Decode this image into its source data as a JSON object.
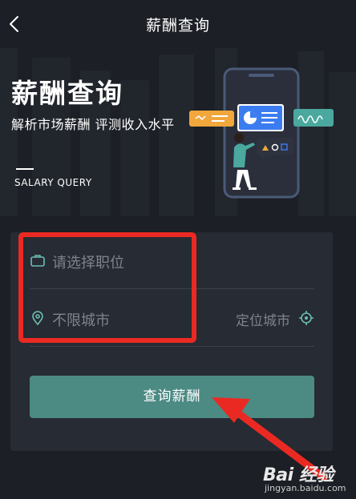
{
  "nav": {
    "title": "薪酬查询",
    "back_icon": "chevron-left-icon"
  },
  "hero": {
    "title": "薪酬查询",
    "subtitle": "解析市场薪酬 评测收入水平",
    "english_label": "SALARY QUERY"
  },
  "form": {
    "job_field": {
      "icon": "briefcase-icon",
      "placeholder": "请选择职位"
    },
    "city_field": {
      "icon": "location-pin-icon",
      "value": "不限城市",
      "locate_label": "定位城市",
      "locate_icon": "crosshair-icon"
    },
    "query_button_label": "查询薪酬"
  },
  "colors": {
    "background": "#1c1f25",
    "card": "#272b33",
    "accent_teal": "#4c8a84",
    "icon_teal": "#6bbdb5",
    "annotation_red": "#ea2a22"
  },
  "watermark": {
    "logo": "Bai 经验",
    "url": "jingyan.baidu.com"
  }
}
